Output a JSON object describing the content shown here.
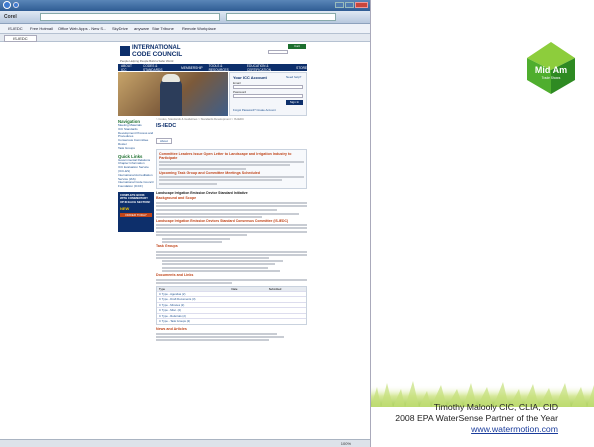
{
  "browser": {
    "tab_label": "IS-IEDC",
    "favorites": [
      "Corel",
      "IS-IEDC",
      "Free Hotmail",
      "Office Web Apps - New S...",
      "SkyDrive",
      "anyware",
      "Star Tribune",
      "Remote Workplace"
    ],
    "status_zoom": "100%"
  },
  "site": {
    "logo_line1": "INTERNATIONAL",
    "logo_line2": "CODE COUNCIL",
    "tagline": "People Helping People Build a Safer World",
    "nav_items": [
      "ABOUT ICC",
      "CODES & STANDARDS",
      "MEMBERSHIP",
      "TOOLS & RESOURCES",
      "EDUCATION & CERTIFICATION",
      "STORE"
    ],
    "login_title": "Your ICC Account",
    "login_sub": "Need help?",
    "login_email": "Email",
    "login_password": "Password",
    "login_button": "Sign In",
    "forgot": "Forgot Password?  Create Account",
    "cart_button": "Cart",
    "breadcrumb": "> Codes, Standards & Guidelines > Standards Development > IS-IEDC",
    "page_title": "IS-IEDC",
    "about_tab": "About",
    "section1": "Committee Leaders Issue Open Letter to Landscape and Irrigation Industry to Participate",
    "section2": "Upcoming Task Group and Committee Meetings Scheduled",
    "section3": "Landscape Irrigation Emission Device Standard Initiative",
    "section3b": "Background and Scope",
    "section4": "Landscape Irrigation Emission Devices Standard Consensus Committee (IS-IEDC)",
    "section5": "Task Groups",
    "section6": "Documents and Links",
    "section7": "News and Articles",
    "table_headers": [
      "Type",
      "Date",
      "Submitted"
    ],
    "table_rows": [
      "C Type - Agendas (2)",
      "C Type - Draft Documents (3)",
      "C Type - Minutes (2)",
      "C Type - Misc. (2)",
      "C Type - Referrals (2)",
      "C Type - Task Groups (2)"
    ]
  },
  "sidebar": {
    "title": "Navigation",
    "items": [
      "Meeting Materials",
      "ICC Standards Development Process and Procedures",
      "Consensus Committee Roster",
      "Task Groups"
    ],
    "quick_title": "Quick Links",
    "quick": [
      "Governmental Relations",
      "Chapter Information",
      "ICC Evaluation Service (ICC-ES)",
      "International Accreditation Service (IAS)",
      "International Code Council Foundation (ICCF)"
    ],
    "promo": "COMPLETE BOOK WITH COMMENTARY UP IN EACH SECTION!",
    "promo_new": "NEW",
    "promo_button": "ORDER TODAY"
  },
  "slide": {
    "logo_text": "Mid Am",
    "logo_sub": "Trade Shows",
    "credit_name": "Timothy Malooly CIC, CLIA, CID",
    "credit_award": "2008 EPA WaterSense Partner of the Year",
    "credit_url": "www.watermotion.com",
    "colors": {
      "logo_green": "#4fae2e",
      "link_blue": "#1a3c9c",
      "nav_navy": "#0d2f6b"
    }
  }
}
